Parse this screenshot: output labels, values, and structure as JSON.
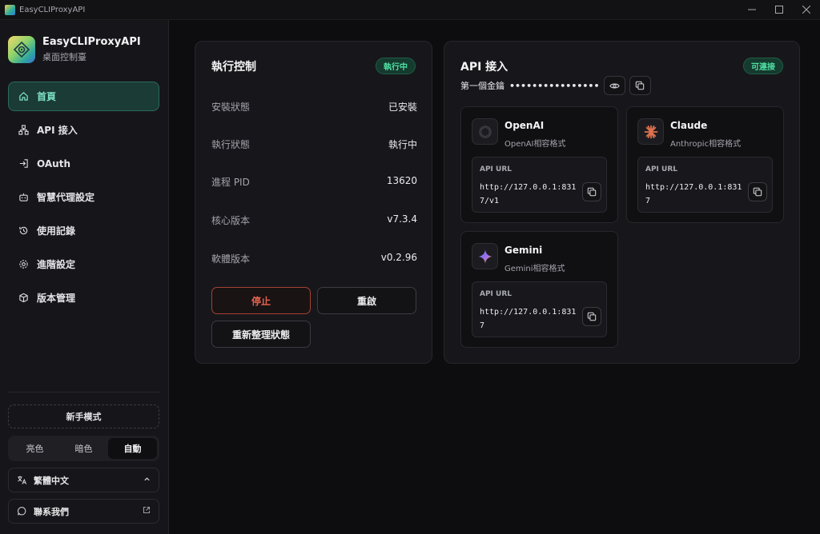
{
  "window": {
    "title": "EasyCLIProxyAPI"
  },
  "brand": {
    "name": "EasyCLIProxyAPI",
    "subtitle": "桌面控制臺"
  },
  "nav": {
    "items": [
      {
        "label": "首頁",
        "icon": "home-icon",
        "active": true
      },
      {
        "label": "API 接入",
        "icon": "network-icon"
      },
      {
        "label": "OAuth",
        "icon": "login-icon"
      },
      {
        "label": "智慧代理設定",
        "icon": "bot-icon"
      },
      {
        "label": "使用記錄",
        "icon": "history-icon"
      },
      {
        "label": "進階設定",
        "icon": "gear-icon"
      },
      {
        "label": "版本管理",
        "icon": "package-icon"
      }
    ]
  },
  "sidebar_bottom": {
    "novice_mode": "新手模式",
    "theme": {
      "light": "亮色",
      "dark": "暗色",
      "auto": "自動",
      "selected": "自動"
    },
    "language": "繁體中文",
    "contact": "聯系我們"
  },
  "exec": {
    "title": "執行控制",
    "badge": "執行中",
    "rows": [
      {
        "key": "安裝狀態",
        "value": "已安裝"
      },
      {
        "key": "執行狀態",
        "value": "執行中"
      },
      {
        "key": "進程 PID",
        "value": "13620"
      },
      {
        "key": "核心版本",
        "value": "v7.3.4"
      },
      {
        "key": "軟體版本",
        "value": "v0.2.96"
      }
    ],
    "stop_label": "停止",
    "restart_label": "重啟",
    "refresh_label": "重新整理狀態"
  },
  "api": {
    "title": "API 接入",
    "badge": "可連接",
    "key_label": "第一個金鑰",
    "key_masked": "••••••••••••••••",
    "url_label": "API URL",
    "providers": [
      {
        "name": "OpenAI",
        "subtitle": "OpenAI相容格式",
        "url": "http://127.0.0.1:8317/v1"
      },
      {
        "name": "Claude",
        "subtitle": "Anthropic相容格式",
        "url": "http://127.0.0.1:8317"
      },
      {
        "name": "Gemini",
        "subtitle": "Gemini相容格式",
        "url": "http://127.0.0.1:8317"
      }
    ]
  },
  "colors": {
    "accent": "#4fe0a3",
    "active_nav_bg": "#1b3b36",
    "stop": "#e7634e",
    "claude": "#e0724f"
  }
}
